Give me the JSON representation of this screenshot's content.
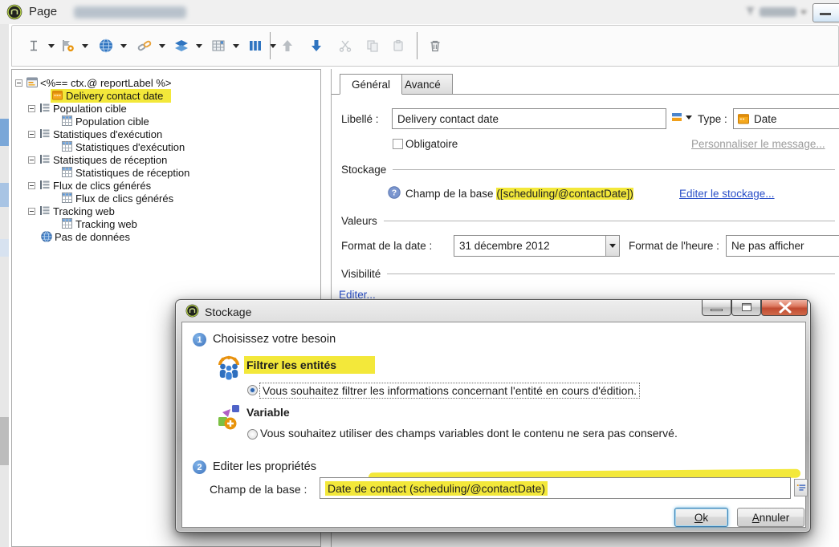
{
  "window": {
    "title": "Page"
  },
  "tree": {
    "root_label": "<%== ctx.@ reportLabel %>",
    "items": [
      {
        "label": "Delivery contact date",
        "highlight": true
      },
      {
        "label": "Population cible"
      },
      {
        "label": "Population cible"
      },
      {
        "label": "Statistiques d'exécution"
      },
      {
        "label": "Statistiques d'exécution"
      },
      {
        "label": "Statistiques de réception"
      },
      {
        "label": "Statistiques de réception"
      },
      {
        "label": "Flux de clics générés"
      },
      {
        "label": "Flux de clics générés"
      },
      {
        "label": "Tracking web"
      },
      {
        "label": "Tracking web"
      },
      {
        "label": "Pas de données"
      }
    ]
  },
  "panel": {
    "tabs": [
      "Général",
      "Avancé"
    ],
    "libelle_label": "Libellé :",
    "libelle_value": "Delivery contact date",
    "type_label": "Type :",
    "type_value": "Date",
    "obligatoire_label": "Obligatoire",
    "personnaliser_link": "Personnaliser le message...",
    "stockage_section": "Stockage",
    "champ_prefix": "Champ de la base ",
    "champ_highlight": "([scheduling/@contactDate])",
    "editer_stockage_link": "Editer le stockage...",
    "valeurs_section": "Valeurs",
    "format_date_label": "Format de la date :",
    "format_date_value": "31 décembre 2012",
    "format_heure_label": "Format de l'heure :",
    "format_heure_value": "Ne pas afficher",
    "visibilite_section": "Visibilité",
    "editer_link": "Editer..."
  },
  "dialog": {
    "title": "Stockage",
    "step1_num": "1",
    "step1_label": "Choisissez votre besoin",
    "option1_title": "Filtrer les entités",
    "option1_desc": "Vous souhaitez filtrer les informations concernant l'entité en cours d'édition.",
    "option2_title": "Variable",
    "option2_desc": "Vous souhaitez utiliser des champs variables dont le contenu ne sera pas conservé.",
    "step2_num": "2",
    "step2_label": "Editer les propriétés",
    "champ_label": "Champ de la base :",
    "champ_value": "Date de contact (scheduling/@contactDate)",
    "ok_label": "Ok",
    "cancel_label": "Annuler"
  },
  "colors": {
    "highlight_yellow": "#f3e83a",
    "link_blue": "#2b50c8",
    "link_gray": "#9b9b9b",
    "accent_blue": "#2f74c0"
  }
}
